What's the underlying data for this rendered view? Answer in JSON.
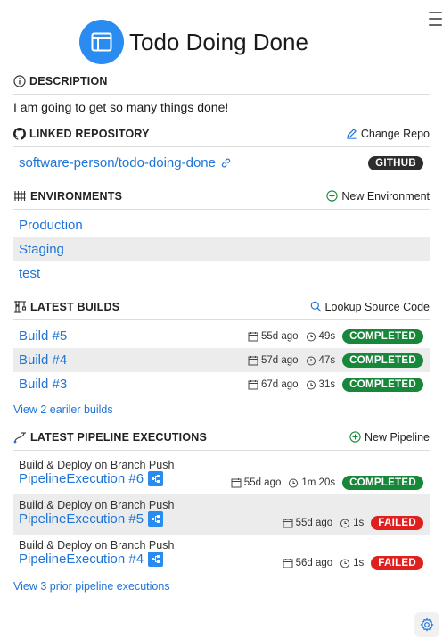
{
  "app": {
    "title": "Todo Doing Done"
  },
  "description": {
    "heading": "DESCRIPTION",
    "text": "I am going to get so many things done!"
  },
  "repository": {
    "heading": "LINKED REPOSITORY",
    "action": "Change Repo",
    "name": "software-person/todo-doing-done",
    "badge": "GITHUB"
  },
  "environments": {
    "heading": "ENVIRONMENTS",
    "action": "New Environment",
    "items": [
      "Production",
      "Staging",
      "test"
    ]
  },
  "builds": {
    "heading": "LATEST BUILDS",
    "action": "Lookup Source Code",
    "items": [
      {
        "name": "Build #5",
        "ago": "55d ago",
        "duration": "49s",
        "status": "COMPLETED"
      },
      {
        "name": "Build #4",
        "ago": "57d ago",
        "duration": "47s",
        "status": "COMPLETED"
      },
      {
        "name": "Build #3",
        "ago": "67d ago",
        "duration": "31s",
        "status": "COMPLETED"
      }
    ],
    "more": "View 2 eariler builds"
  },
  "pipelines": {
    "heading": "LATEST PIPELINE EXECUTIONS",
    "action": "New Pipeline",
    "items": [
      {
        "trigger": "Build & Deploy on Branch Push",
        "name": "PipelineExecution #6",
        "ago": "55d ago",
        "duration": "1m 20s",
        "status": "COMPLETED"
      },
      {
        "trigger": "Build & Deploy on Branch Push",
        "name": "PipelineExecution #5",
        "ago": "55d ago",
        "duration": "1s",
        "status": "FAILED"
      },
      {
        "trigger": "Build & Deploy on Branch Push",
        "name": "PipelineExecution #4",
        "ago": "56d ago",
        "duration": "1s",
        "status": "FAILED"
      }
    ],
    "more": "View 3 prior pipeline executions"
  },
  "colors": {
    "accent": "#1f74d8",
    "success": "#17873a",
    "failure": "#e0201f",
    "logo": "#2a8cf0"
  }
}
